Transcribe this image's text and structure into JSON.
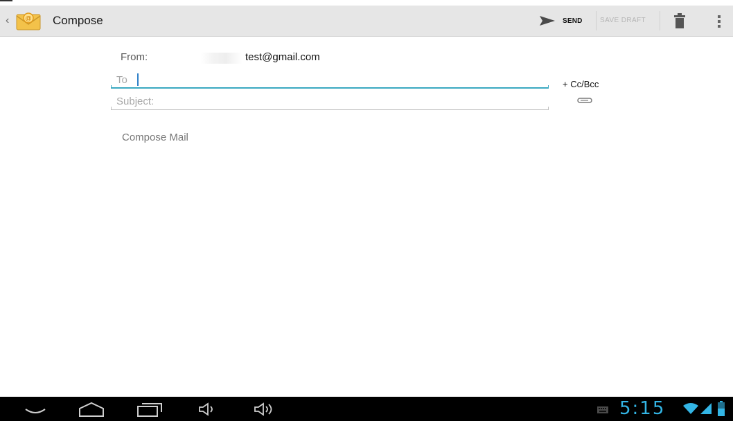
{
  "actionbar": {
    "title": "Compose",
    "send_label": "SEND",
    "save_draft_label": "SAVE DRAFT"
  },
  "compose": {
    "from_label": "From:",
    "from_value": "test@gmail.com",
    "to_placeholder": "To",
    "cc_bcc_label": "+ Cc/Bcc",
    "subject_placeholder": "Subject:",
    "body_placeholder": "Compose Mail"
  },
  "statusbar": {
    "clock": "5:15"
  },
  "colors": {
    "accent": "#33b5e5",
    "focus_underline": "#3aa8c1",
    "actionbar_bg": "#e6e6e6"
  },
  "icons": {
    "app": "email-envelope-icon",
    "send": "send-arrow-icon",
    "trash": "trash-icon",
    "overflow": "overflow-menu-icon",
    "attach": "paperclip-icon",
    "nav": [
      "back-icon",
      "home-icon",
      "recent-apps-icon",
      "volume-down-icon",
      "volume-up-icon"
    ],
    "status": [
      "keyboard-icon",
      "wifi-icon",
      "signal-icon",
      "battery-icon"
    ]
  }
}
